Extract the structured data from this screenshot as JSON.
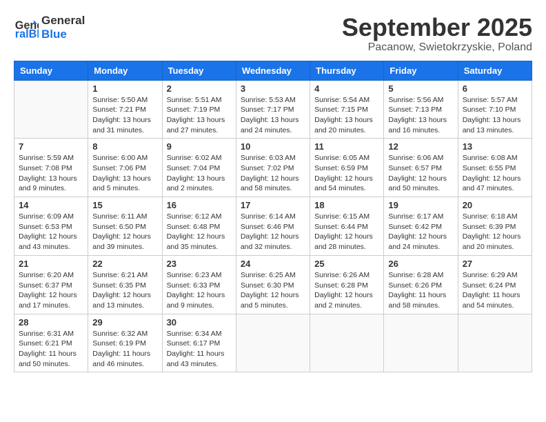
{
  "logo": {
    "line1": "General",
    "line2": "Blue"
  },
  "title": "September 2025",
  "location": "Pacanow, Swietokrzyskie, Poland",
  "weekdays": [
    "Sunday",
    "Monday",
    "Tuesday",
    "Wednesday",
    "Thursday",
    "Friday",
    "Saturday"
  ],
  "weeks": [
    [
      {
        "day": "",
        "info": ""
      },
      {
        "day": "1",
        "info": "Sunrise: 5:50 AM\nSunset: 7:21 PM\nDaylight: 13 hours\nand 31 minutes."
      },
      {
        "day": "2",
        "info": "Sunrise: 5:51 AM\nSunset: 7:19 PM\nDaylight: 13 hours\nand 27 minutes."
      },
      {
        "day": "3",
        "info": "Sunrise: 5:53 AM\nSunset: 7:17 PM\nDaylight: 13 hours\nand 24 minutes."
      },
      {
        "day": "4",
        "info": "Sunrise: 5:54 AM\nSunset: 7:15 PM\nDaylight: 13 hours\nand 20 minutes."
      },
      {
        "day": "5",
        "info": "Sunrise: 5:56 AM\nSunset: 7:13 PM\nDaylight: 13 hours\nand 16 minutes."
      },
      {
        "day": "6",
        "info": "Sunrise: 5:57 AM\nSunset: 7:10 PM\nDaylight: 13 hours\nand 13 minutes."
      }
    ],
    [
      {
        "day": "7",
        "info": "Sunrise: 5:59 AM\nSunset: 7:08 PM\nDaylight: 13 hours\nand 9 minutes."
      },
      {
        "day": "8",
        "info": "Sunrise: 6:00 AM\nSunset: 7:06 PM\nDaylight: 13 hours\nand 5 minutes."
      },
      {
        "day": "9",
        "info": "Sunrise: 6:02 AM\nSunset: 7:04 PM\nDaylight: 13 hours\nand 2 minutes."
      },
      {
        "day": "10",
        "info": "Sunrise: 6:03 AM\nSunset: 7:02 PM\nDaylight: 12 hours\nand 58 minutes."
      },
      {
        "day": "11",
        "info": "Sunrise: 6:05 AM\nSunset: 6:59 PM\nDaylight: 12 hours\nand 54 minutes."
      },
      {
        "day": "12",
        "info": "Sunrise: 6:06 AM\nSunset: 6:57 PM\nDaylight: 12 hours\nand 50 minutes."
      },
      {
        "day": "13",
        "info": "Sunrise: 6:08 AM\nSunset: 6:55 PM\nDaylight: 12 hours\nand 47 minutes."
      }
    ],
    [
      {
        "day": "14",
        "info": "Sunrise: 6:09 AM\nSunset: 6:53 PM\nDaylight: 12 hours\nand 43 minutes."
      },
      {
        "day": "15",
        "info": "Sunrise: 6:11 AM\nSunset: 6:50 PM\nDaylight: 12 hours\nand 39 minutes."
      },
      {
        "day": "16",
        "info": "Sunrise: 6:12 AM\nSunset: 6:48 PM\nDaylight: 12 hours\nand 35 minutes."
      },
      {
        "day": "17",
        "info": "Sunrise: 6:14 AM\nSunset: 6:46 PM\nDaylight: 12 hours\nand 32 minutes."
      },
      {
        "day": "18",
        "info": "Sunrise: 6:15 AM\nSunset: 6:44 PM\nDaylight: 12 hours\nand 28 minutes."
      },
      {
        "day": "19",
        "info": "Sunrise: 6:17 AM\nSunset: 6:42 PM\nDaylight: 12 hours\nand 24 minutes."
      },
      {
        "day": "20",
        "info": "Sunrise: 6:18 AM\nSunset: 6:39 PM\nDaylight: 12 hours\nand 20 minutes."
      }
    ],
    [
      {
        "day": "21",
        "info": "Sunrise: 6:20 AM\nSunset: 6:37 PM\nDaylight: 12 hours\nand 17 minutes."
      },
      {
        "day": "22",
        "info": "Sunrise: 6:21 AM\nSunset: 6:35 PM\nDaylight: 12 hours\nand 13 minutes."
      },
      {
        "day": "23",
        "info": "Sunrise: 6:23 AM\nSunset: 6:33 PM\nDaylight: 12 hours\nand 9 minutes."
      },
      {
        "day": "24",
        "info": "Sunrise: 6:25 AM\nSunset: 6:30 PM\nDaylight: 12 hours\nand 5 minutes."
      },
      {
        "day": "25",
        "info": "Sunrise: 6:26 AM\nSunset: 6:28 PM\nDaylight: 12 hours\nand 2 minutes."
      },
      {
        "day": "26",
        "info": "Sunrise: 6:28 AM\nSunset: 6:26 PM\nDaylight: 11 hours\nand 58 minutes."
      },
      {
        "day": "27",
        "info": "Sunrise: 6:29 AM\nSunset: 6:24 PM\nDaylight: 11 hours\nand 54 minutes."
      }
    ],
    [
      {
        "day": "28",
        "info": "Sunrise: 6:31 AM\nSunset: 6:21 PM\nDaylight: 11 hours\nand 50 minutes."
      },
      {
        "day": "29",
        "info": "Sunrise: 6:32 AM\nSunset: 6:19 PM\nDaylight: 11 hours\nand 46 minutes."
      },
      {
        "day": "30",
        "info": "Sunrise: 6:34 AM\nSunset: 6:17 PM\nDaylight: 11 hours\nand 43 minutes."
      },
      {
        "day": "",
        "info": ""
      },
      {
        "day": "",
        "info": ""
      },
      {
        "day": "",
        "info": ""
      },
      {
        "day": "",
        "info": ""
      }
    ]
  ]
}
